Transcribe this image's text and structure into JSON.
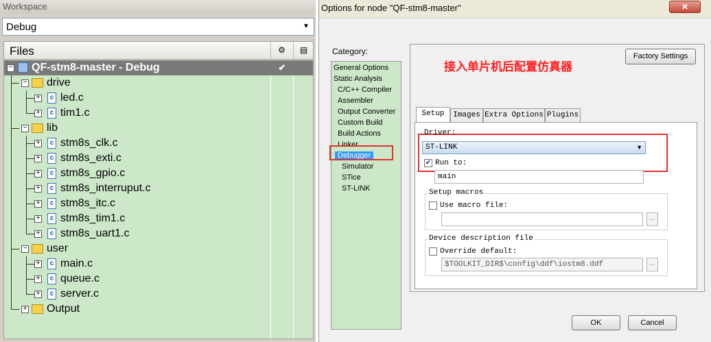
{
  "workspace": {
    "title": "Workspace",
    "config": "Debug",
    "files_header": "Files",
    "header_icon1": "options-icon",
    "header_icon2": "compile-icon",
    "tree": [
      {
        "label": "QF-stm8-master - Debug",
        "level": 0,
        "type": "project",
        "checked": "✔"
      },
      {
        "label": "drive",
        "level": 1,
        "type": "folder"
      },
      {
        "label": "led.c",
        "level": 2,
        "type": "file"
      },
      {
        "label": "tim1.c",
        "level": 2,
        "type": "file"
      },
      {
        "label": "lib",
        "level": 1,
        "type": "folder"
      },
      {
        "label": "stm8s_clk.c",
        "level": 2,
        "type": "file"
      },
      {
        "label": "stm8s_exti.c",
        "level": 2,
        "type": "file"
      },
      {
        "label": "stm8s_gpio.c",
        "level": 2,
        "type": "file"
      },
      {
        "label": "stm8s_interruput.c",
        "level": 2,
        "type": "file"
      },
      {
        "label": "stm8s_itc.c",
        "level": 2,
        "type": "file"
      },
      {
        "label": "stm8s_tim1.c",
        "level": 2,
        "type": "file"
      },
      {
        "label": "stm8s_uart1.c",
        "level": 2,
        "type": "file"
      },
      {
        "label": "user",
        "level": 1,
        "type": "folder"
      },
      {
        "label": "main.c",
        "level": 2,
        "type": "file"
      },
      {
        "label": "queue.c",
        "level": 2,
        "type": "file"
      },
      {
        "label": "server.c",
        "level": 2,
        "type": "file"
      },
      {
        "label": "Output",
        "level": 1,
        "type": "folder-collapsed"
      }
    ]
  },
  "dialog": {
    "title": "Options for node \"QF-stm8-master\"",
    "close": "✕",
    "category_label": "Category:",
    "categories": [
      {
        "label": "General Options",
        "indent": 0
      },
      {
        "label": "Static Analysis",
        "indent": 0
      },
      {
        "label": "C/C++ Compiler",
        "indent": 1
      },
      {
        "label": "Assembler",
        "indent": 1
      },
      {
        "label": "Output Converter",
        "indent": 1
      },
      {
        "label": "Custom Build",
        "indent": 1
      },
      {
        "label": "Build Actions",
        "indent": 1
      },
      {
        "label": "Linker",
        "indent": 1
      },
      {
        "label": "Debugger",
        "indent": 1,
        "selected": true
      },
      {
        "label": "Simulator",
        "indent": 2
      },
      {
        "label": "STice",
        "indent": 2
      },
      {
        "label": "ST-LINK",
        "indent": 2
      }
    ],
    "factory_settings": "Factory Settings",
    "annotation": "接入单片机后配置仿真器",
    "tabs": [
      "Setup",
      "Images",
      "Extra Options",
      "Plugins"
    ],
    "driver_label": "Driver:",
    "driver_value": "ST-LINK",
    "run_to_label": "Run to:",
    "run_to_checked": "✔",
    "run_to_value": "main",
    "setup_macros_title": "Setup macros",
    "use_macro_label": "Use macro file:",
    "macro_file_value": "",
    "device_desc_title": "Device description file",
    "override_label": "Override default:",
    "override_value": "$TOOLKIT_DIR$\\config\\ddf\\iostm8.ddf",
    "browse": "...",
    "ok": "OK",
    "cancel": "Cancel",
    "colors": {
      "annotation": "#ff2020",
      "highlight_box": "#e03030",
      "selection": "#3399ff",
      "tree_bg": "#cde8c9"
    }
  }
}
